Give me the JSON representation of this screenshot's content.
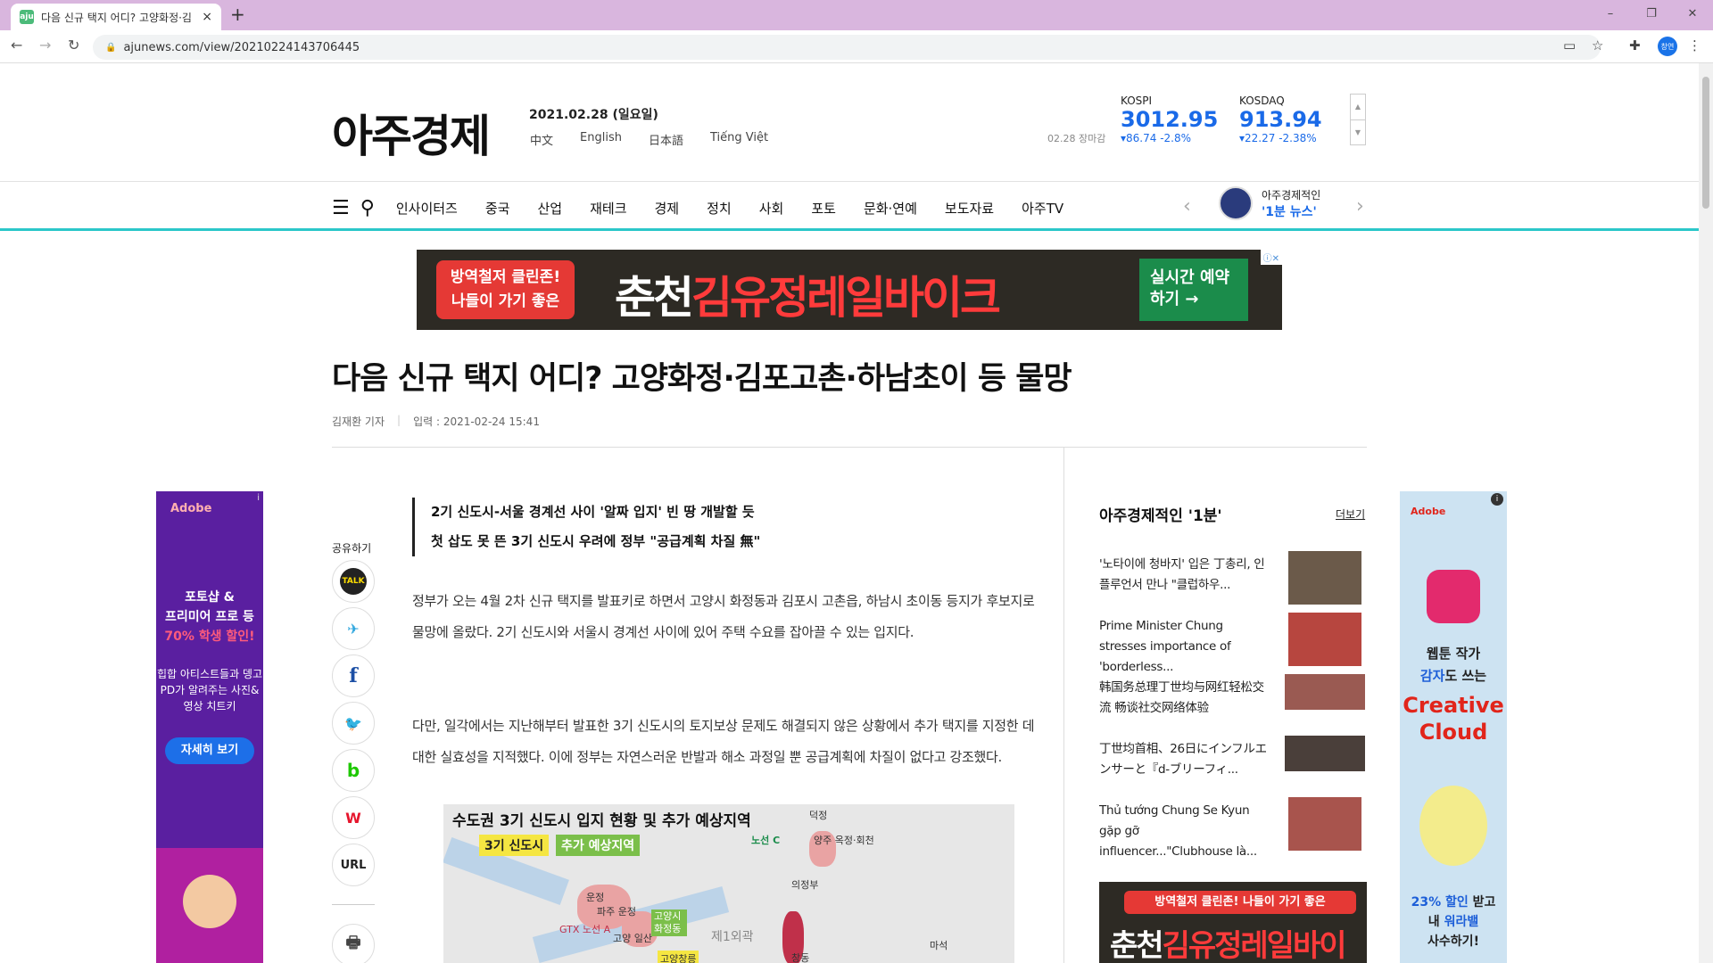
{
  "browser": {
    "tab_title": "다음 신규 택지 어디? 고양화정·김",
    "tab_favicon": "aju",
    "tab_close": "×",
    "new_tab": "+",
    "url": "ajunews.com/view/20210224143706445",
    "profile": "창연",
    "win_min": "–",
    "win_max": "❐",
    "win_close": "✕"
  },
  "site": {
    "logo": "아주경제",
    "date": "2021.02.28 (일요일)",
    "languages": [
      "中文",
      "English",
      "日本語",
      "Tiếng Việt"
    ],
    "market_close": "02.28 장마감",
    "kospi": {
      "name": "KOSPI",
      "value": "3012.95",
      "change": "▾86.74  -2.8%"
    },
    "kosdaq": {
      "name": "KOSDAQ",
      "value": "913.94",
      "change": "▾22.27  -2.38%"
    },
    "menu": [
      "인사이터즈",
      "중국",
      "산업",
      "재테크",
      "경제",
      "정치",
      "사회",
      "포토",
      "문화·연예",
      "보도자료",
      "아주TV"
    ],
    "promo_line1": "아주경제적인",
    "promo_line2": "'1분 뉴스'"
  },
  "top_banner": {
    "left_text": "방역철저 클린존! 나들이 가기 좋은",
    "main_prefix": "춘천",
    "main_highlight": "김유정레일바이크",
    "cta": "실시간 예약하기 →",
    "ad_mark": "ⓘ✕"
  },
  "article": {
    "headline": "다음 신규 택지 어디? 고양화정·김포고촌·하남초이 등 물망",
    "reporter": "김재환 기자",
    "published": "입력 : 2021-02-24 15:41",
    "summary": [
      "2기 신도시-서울 경계선 사이 '알짜 입지' 빈 땅 개발할 듯",
      "첫 삽도 못 뜬 3기 신도시 우려에 정부 \"공급계획 차질 無\""
    ],
    "para1": "정부가 오는 4월 2차 신규 택지를 발표키로 하면서 고양시 화정동과 김포시 고촌읍, 하남시 초이동 등지가 후보지로 물망에 올랐다. 2기 신도시와 서울시 경계선 사이에 있어 주택 수요를 잡아끌 수 있는 입지다.",
    "para2": "다만, 일각에서는 지난해부터 발표한 3기 신도시의 토지보상 문제도 해결되지 않은 상황에서 추가 택지를 지정한 데 대한 실효성을 지적했다. 이에 정부는 자연스러운 반발과 해소 과정일 뿐 공급계획에 차질이 없다고 강조했다."
  },
  "map": {
    "title": "수도권 3기 신도시 입지 현황 및 추가 예상지역",
    "legend_existing": "3기 신도시",
    "legend_expected": "추가 예상지역",
    "labels": [
      "덕정",
      "노선 C",
      "양주 옥정·회천",
      "의정부",
      "운정",
      "파주 운정",
      "GTX 노선 A",
      "고양 일산",
      "고양시 화정동",
      "제1외곽",
      "고양창릉",
      "창동",
      "마석"
    ]
  },
  "share": {
    "label": "공유하기",
    "buttons": [
      "TALK",
      "✈",
      "f",
      "🐦",
      "b",
      "W",
      "URL",
      "🖶"
    ]
  },
  "sidebar": {
    "title": "아주경제적인 '1분'",
    "more": "더보기",
    "items": [
      "'노타이에 청바지' 입은 丁총리, 인플루언서 만나 \"클럽하우...",
      "Prime Minister Chung stresses importance of 'borderless...",
      "韩国务总理丁世均与网红轻松交流 畅谈社交网络体验",
      "丁世均首相、26日にインフルエンサーと『d-ブリーフィ...",
      "Thủ tướng Chung Se Kyun gặp gỡ influencer...\"Clubhouse là..."
    ],
    "banner_top": "방역철저 클린존! 나들이 가기 좋은",
    "banner_prefix": "춘천",
    "banner_highlight": "김유정레일바이크"
  },
  "ad_left": {
    "brand": "Adobe",
    "line1a": "포토샵 &",
    "line1b": "프리미어 프로 등",
    "line1c": "70% 학생 할인!",
    "line2": "힙합 아티스트들과 뎅고 PD가 알려주는 사진&영상 치트키",
    "button": "자세히 보기",
    "info": "i"
  },
  "ad_right": {
    "brand": "Adobe",
    "line1a": "웹툰 작가",
    "line1b": "감자",
    "line1c": "도 쓰는",
    "line2a": "Creative",
    "line2b": "Cloud",
    "line3a": "23% 할인",
    "line3b": "받고",
    "line3c": "내 ",
    "line3d": "워라밸",
    "line3e": "사수하기!",
    "info": "i"
  },
  "colors": {
    "accent": "#1a6ae8",
    "nav_line": "#2bc7c9",
    "tab_bar": "#d9b6de"
  }
}
